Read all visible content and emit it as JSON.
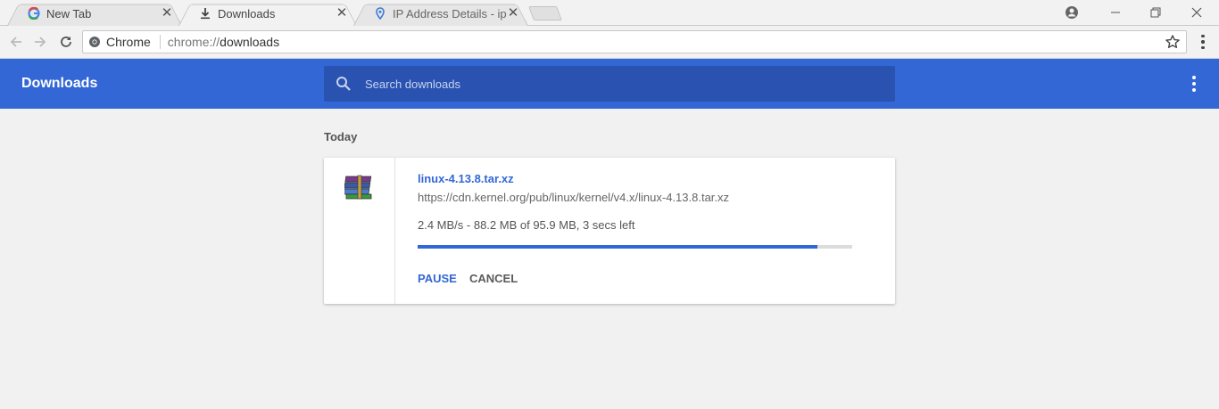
{
  "tabs": [
    {
      "title": "New Tab",
      "icon": "google-icon",
      "active": false
    },
    {
      "title": "Downloads",
      "icon": "download-icon",
      "active": true
    },
    {
      "title": "IP Address Details - ipinfo",
      "icon": "location-pin-icon",
      "active": false
    }
  ],
  "omnibox": {
    "chip_label": "Chrome",
    "url_scheme": "chrome://",
    "url_path": "downloads"
  },
  "header": {
    "title": "Downloads",
    "search_placeholder": "Search downloads"
  },
  "list": {
    "date_label": "Today",
    "items": [
      {
        "file_name": "linux-4.13.8.tar.xz",
        "url": "https://cdn.kernel.org/pub/linux/kernel/v4.x/linux-4.13.8.tar.xz",
        "status": "2.4 MB/s - 88.2 MB of 95.9 MB, 3 secs left",
        "progress_fraction": 0.92,
        "pause_label": "PAUSE",
        "cancel_label": "CANCEL"
      }
    ]
  },
  "colors": {
    "accent": "#3367d6",
    "header_bg": "#3367d6",
    "search_bg": "#2a52b0"
  }
}
